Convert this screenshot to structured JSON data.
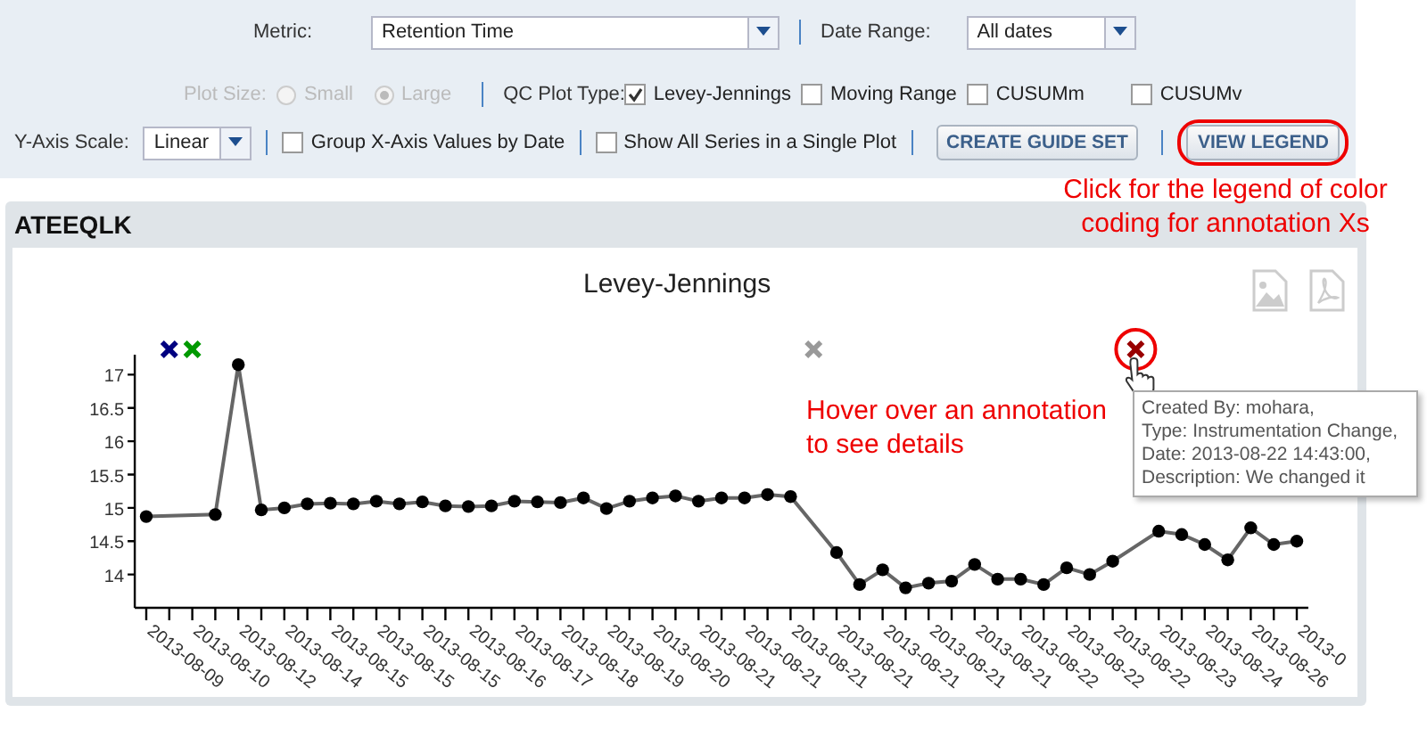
{
  "toolbar": {
    "metric": {
      "label": "Metric:",
      "value": "Retention Time"
    },
    "date_range": {
      "label": "Date Range:",
      "value": "All dates"
    },
    "plot_size": {
      "label": "Plot Size:",
      "disabled": true,
      "options": [
        {
          "label": "Small",
          "selected": false
        },
        {
          "label": "Large",
          "selected": true
        }
      ]
    },
    "qc_plot_type": {
      "label": "QC Plot Type:",
      "options": [
        {
          "label": "Levey-Jennings",
          "checked": true
        },
        {
          "label": "Moving Range",
          "checked": false
        },
        {
          "label": "CUSUMm",
          "checked": false
        },
        {
          "label": "CUSUMv",
          "checked": false
        }
      ]
    },
    "y_axis_scale": {
      "label": "Y-Axis Scale:",
      "value": "Linear"
    },
    "options": [
      {
        "label": "Group X-Axis Values by Date",
        "checked": false
      },
      {
        "label": "Show All Series in a Single Plot",
        "checked": false
      }
    ],
    "buttons": [
      {
        "label": "CREATE GUIDE SET",
        "circled": false
      },
      {
        "label": "VIEW LEGEND",
        "circled": true
      }
    ]
  },
  "legend_callout": "Click for the legend of color coding for annotation Xs",
  "panel": {
    "title": "ATEEQLK",
    "chart_title": "Levey-Jennings",
    "hover_callout": "Hover over an annotation to see details",
    "tooltip": [
      "Created By: mohara,",
      "Type: Instrumentation Change,",
      "Date: 2013-08-22 14:43:00,",
      "Description: We changed it"
    ],
    "annotation_markers": [
      {
        "color": "#000080",
        "circled": false
      },
      {
        "color": "#009900",
        "circled": false
      },
      {
        "color": "#999999",
        "circled": false
      },
      {
        "color": "#990000",
        "circled": true
      }
    ],
    "chart_data": {
      "type": "line",
      "marker": "circle",
      "categories": [
        "2013-08-09",
        null,
        "2013-08-10",
        null,
        "2013-08-12",
        null,
        "2013-08-14",
        null,
        "2013-08-15",
        null,
        "2013-08-15",
        null,
        "2013-08-15",
        null,
        "2013-08-16",
        null,
        "2013-08-17",
        null,
        "2013-08-18",
        null,
        "2013-08-19",
        null,
        "2013-08-20",
        null,
        "2013-08-21",
        null,
        "2013-08-21",
        null,
        "2013-08-21",
        null,
        "2013-08-21",
        null,
        "2013-08-21",
        null,
        "2013-08-21",
        null,
        "2013-08-21",
        null,
        "2013-08-22",
        null,
        "2013-08-22",
        null,
        "2013-08-22",
        null,
        "2013-08-23",
        null,
        "2013-08-24",
        null,
        "2013-08-26",
        null,
        "2013-0"
      ],
      "values": [
        14.87,
        null,
        null,
        14.9,
        17.15,
        14.97,
        15.0,
        15.06,
        15.07,
        15.06,
        15.1,
        15.06,
        15.09,
        15.03,
        15.02,
        15.03,
        15.1,
        15.09,
        15.08,
        15.15,
        14.99,
        15.1,
        15.15,
        15.18,
        15.1,
        15.15,
        15.15,
        15.2,
        15.17,
        null,
        14.33,
        13.85,
        14.07,
        13.8,
        13.87,
        13.9,
        14.15,
        13.93,
        13.93,
        13.85,
        14.1,
        14.0,
        14.2,
        null,
        14.65,
        14.6,
        14.45,
        14.22,
        14.7,
        14.45,
        14.5
      ],
      "ylim": [
        13.5,
        17.3
      ],
      "yticks": [
        14,
        14.5,
        15,
        15.5,
        16,
        16.5,
        17
      ]
    }
  }
}
